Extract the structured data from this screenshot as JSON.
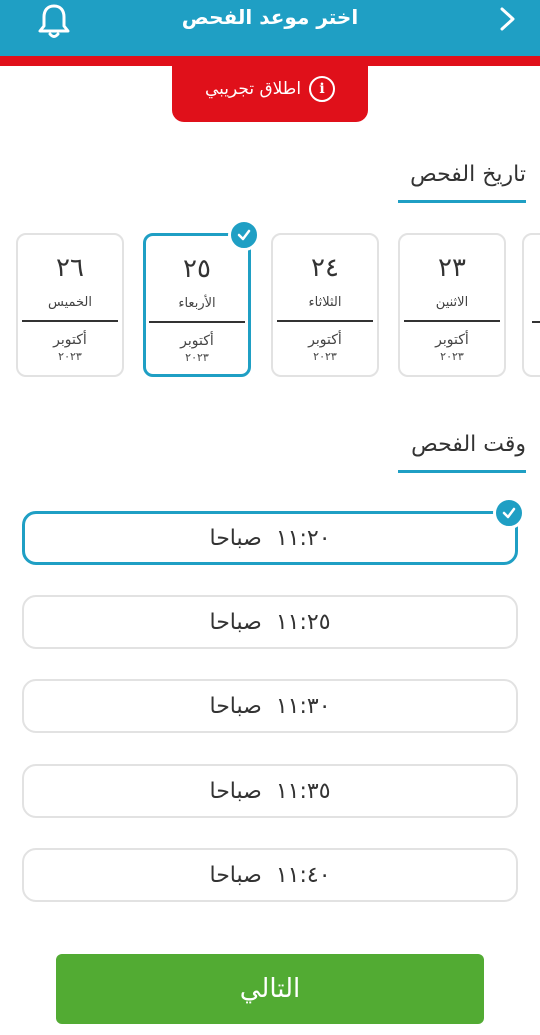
{
  "header": {
    "title": "اختر موعد الفحص",
    "beta_label": "اطلاق تجريبي"
  },
  "date_section": {
    "title": "تاريخ الفحص",
    "dates": [
      {
        "day_num": "٢٦",
        "day_name": "الخميس",
        "month": "أكتوبر",
        "year": "٢٠٢٣",
        "selected": false
      },
      {
        "day_num": "٢٥",
        "day_name": "الأربعاء",
        "month": "أكتوبر",
        "year": "٢٠٢٣",
        "selected": true
      },
      {
        "day_num": "٢٤",
        "day_name": "الثلاثاء",
        "month": "أكتوبر",
        "year": "٢٠٢٣",
        "selected": false
      },
      {
        "day_num": "٢٣",
        "day_name": "الاثنين",
        "month": "أكتوبر",
        "year": "٢٠٢٣",
        "selected": false
      }
    ]
  },
  "time_section": {
    "title": "وقت الفحص",
    "slots": [
      {
        "time": "١١:٢٠",
        "period": "صباحا",
        "selected": true
      },
      {
        "time": "١١:٢٥",
        "period": "صباحا",
        "selected": false
      },
      {
        "time": "١١:٣٠",
        "period": "صباحا",
        "selected": false
      },
      {
        "time": "١١:٣٥",
        "period": "صباحا",
        "selected": false
      },
      {
        "time": "١١:٤٠",
        "period": "صباحا",
        "selected": false
      }
    ]
  },
  "footer": {
    "next_label": "التالي"
  },
  "colors": {
    "primary": "#1f9fc4",
    "alert": "#e0101a",
    "success": "#52ab33"
  },
  "icons": {
    "notifications": "bell-icon",
    "back": "chevron-right-icon",
    "info": "info-icon",
    "selected": "check-icon"
  }
}
